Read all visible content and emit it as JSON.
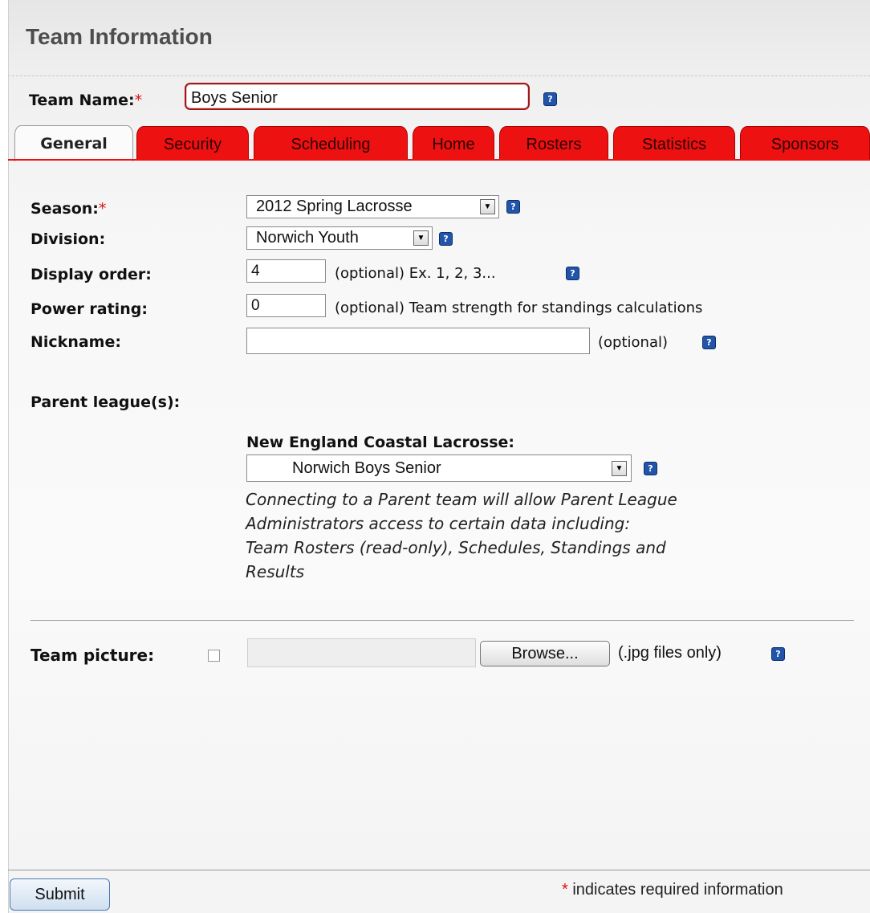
{
  "header": {
    "title": "Team Information"
  },
  "team_name": {
    "label": "Team Name:",
    "required_mark": "*",
    "value": "Boys Senior"
  },
  "tabs": [
    {
      "label": "General",
      "active": true
    },
    {
      "label": "Security"
    },
    {
      "label": "Scheduling"
    },
    {
      "label": "Home"
    },
    {
      "label": "Rosters"
    },
    {
      "label": "Statistics"
    },
    {
      "label": "Sponsors"
    }
  ],
  "form": {
    "season": {
      "label": "Season:",
      "required_mark": "*",
      "value": "2012 Spring Lacrosse"
    },
    "division": {
      "label": "Division:",
      "value": "Norwich Youth"
    },
    "display_order": {
      "label": "Display order:",
      "value": "4",
      "note": "(optional) Ex. 1, 2, 3..."
    },
    "power_rating": {
      "label": "Power rating:",
      "value": "0",
      "note": "(optional) Team strength for standings calculations"
    },
    "nickname": {
      "label": "Nickname:",
      "value": "",
      "note": "(optional)"
    },
    "parent_leagues": {
      "label": "Parent league(s):",
      "league_name": "New England Coastal Lacrosse:",
      "selected_team": "Norwich Boys Senior",
      "notice_lines": [
        "Connecting to a Parent team will allow Parent League",
        "Administrators access to certain data including:",
        "Team Rosters (read-only), Schedules, Standings and",
        "Results"
      ]
    },
    "team_picture": {
      "label": "Team picture:",
      "browse_label": "Browse...",
      "note": "(.jpg files only)"
    }
  },
  "footer": {
    "submit_label": "Submit",
    "required_mark": "*",
    "required_note": "indicates required information"
  },
  "icons": {
    "help": "help-icon",
    "dropdown": "dropdown-arrow-icon"
  },
  "colors": {
    "tab_red": "#ee1111",
    "help_blue": "#2255aa",
    "required_red": "#dd1111"
  }
}
